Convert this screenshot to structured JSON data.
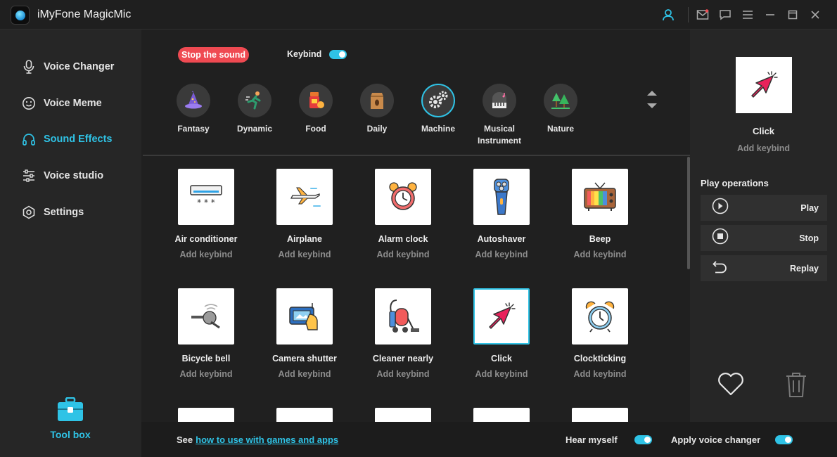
{
  "app": {
    "title": "iMyFone MagicMic"
  },
  "colors": {
    "accent": "#2fc3e6",
    "stop": "#ef4a52"
  },
  "sidebar": {
    "items": [
      {
        "label": "Voice Changer",
        "icon": "microphone-icon"
      },
      {
        "label": "Voice Meme",
        "icon": "smiley-icon"
      },
      {
        "label": "Sound Effects",
        "icon": "headphones-icon",
        "active": true
      },
      {
        "label": "Voice studio",
        "icon": "sliders-icon"
      },
      {
        "label": "Settings",
        "icon": "gear-icon"
      }
    ],
    "toolbox_label": "Tool box"
  },
  "toolbar": {
    "stop_label": "Stop the sound",
    "keybind_label": "Keybind",
    "keybind_on": true
  },
  "categories": [
    {
      "label": "Fantasy"
    },
    {
      "label": "Dynamic"
    },
    {
      "label": "Food"
    },
    {
      "label": "Daily"
    },
    {
      "label": "Machine",
      "active": true
    },
    {
      "label": "Musical Instrument"
    },
    {
      "label": "Nature"
    }
  ],
  "sounds": [
    {
      "name": "Air conditioner",
      "keybind": "Add keybind"
    },
    {
      "name": "Airplane",
      "keybind": "Add keybind"
    },
    {
      "name": "Alarm clock",
      "keybind": "Add keybind"
    },
    {
      "name": "Autoshaver",
      "keybind": "Add keybind"
    },
    {
      "name": "Beep",
      "keybind": "Add keybind"
    },
    {
      "name": "Bicycle bell",
      "keybind": "Add keybind"
    },
    {
      "name": "Camera shutter",
      "keybind": "Add keybind"
    },
    {
      "name": "Cleaner nearly",
      "keybind": "Add keybind"
    },
    {
      "name": "Click",
      "keybind": "Add keybind",
      "selected": true
    },
    {
      "name": "Clockticking",
      "keybind": "Add keybind"
    }
  ],
  "preview": {
    "name": "Click",
    "keybind": "Add keybind",
    "ops_title": "Play operations",
    "ops": [
      {
        "label": "Play",
        "icon": "play-icon"
      },
      {
        "label": "Stop",
        "icon": "stop-icon"
      },
      {
        "label": "Replay",
        "icon": "replay-icon"
      }
    ]
  },
  "bottom": {
    "see_label": "See",
    "link_label": "how to use with games and apps",
    "hear_myself_label": "Hear myself",
    "apply_label": "Apply voice changer"
  }
}
